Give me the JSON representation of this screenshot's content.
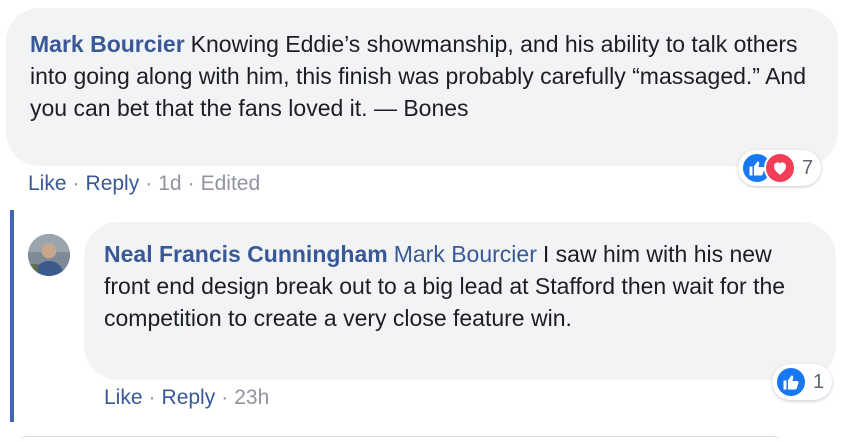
{
  "comment1": {
    "author": "Mark Bourcier",
    "text": "Knowing Eddie’s showmanship, and his ability to talk others into going along with him, this finish was probably carefully “massaged.” And you can bet that the fans loved it. — Bones",
    "actions": {
      "like_label": "Like",
      "reply_label": "Reply",
      "time": "1d",
      "edited_label": "Edited"
    },
    "reactions": {
      "count": "7",
      "types": [
        "like-icon",
        "love-icon"
      ]
    }
  },
  "reply1": {
    "author": "Neal Francis Cunningham",
    "mention": "Mark Bourcier",
    "text": "I saw him with his new front end design break out to a big lead at Stafford then wait for the competition to create a very close feature win.",
    "actions": {
      "like_label": "Like",
      "reply_label": "Reply",
      "time": "23h"
    },
    "reactions": {
      "count": "1",
      "types": [
        "like-icon"
      ]
    }
  },
  "colors": {
    "link_blue": "#385898",
    "bubble_bg": "#f2f3f5",
    "meta_gray": "#90949c",
    "like_blue": "#1877f2",
    "love_red": "#f33e58",
    "thread_line": "#4267b2"
  }
}
